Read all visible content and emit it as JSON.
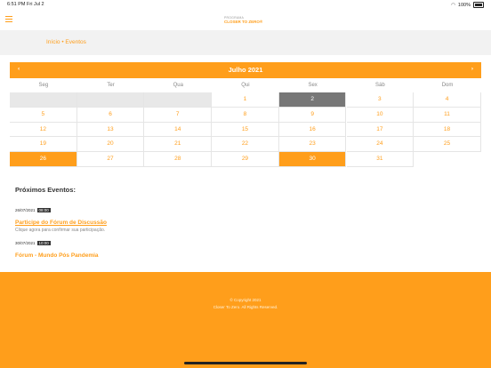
{
  "status": {
    "time": "6:51 PM",
    "date": "Fri Jul 2",
    "battery": "100%"
  },
  "header": {
    "logo_line1": "PROGRAMA",
    "logo_line2": "CLOSER TO ZERO®"
  },
  "breadcrumb": "Início • Eventos",
  "calendar": {
    "title": "Julho 2021",
    "prev": "‹",
    "next": "›",
    "weekdays": [
      "Seg",
      "Ter",
      "Qua",
      "Qui",
      "Sex",
      "Sáb",
      "Dom"
    ],
    "rows": [
      [
        "",
        "",
        "",
        "1",
        "2",
        "3",
        "4"
      ],
      [
        "5",
        "6",
        "7",
        "8",
        "9",
        "10",
        "11"
      ],
      [
        "12",
        "13",
        "14",
        "15",
        "16",
        "17",
        "18"
      ],
      [
        "19",
        "20",
        "21",
        "22",
        "23",
        "24",
        "25"
      ],
      [
        "26",
        "27",
        "28",
        "29",
        "30",
        "31",
        ""
      ]
    ],
    "today": "2",
    "event_days": [
      "26",
      "30"
    ]
  },
  "events": {
    "title": "Próximos Eventos:",
    "items": [
      {
        "date": "26/07/2021",
        "hour": "08:00",
        "name": "Participe do Fórum de Discussão",
        "desc": "Clique agora para confirmar sua participação."
      },
      {
        "date": "30/07/2021",
        "hour": "10:00",
        "name": "Fórum - Mundo Pós Pandemia",
        "desc": ""
      }
    ]
  },
  "footer": {
    "line1": "© Copyright 2021",
    "line2": "Closer To Zero. All Rights Reserved."
  },
  "colors": {
    "accent": "#ff9e1b",
    "today": "#777777"
  }
}
